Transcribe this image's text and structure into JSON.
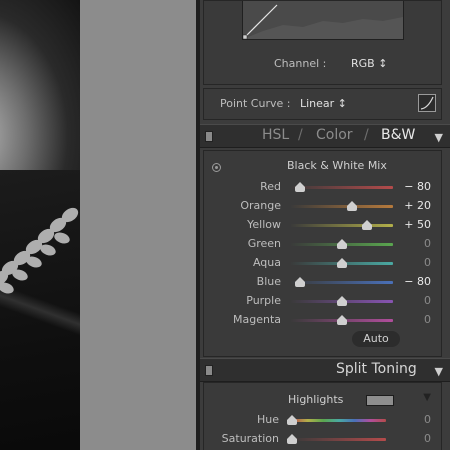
{
  "tone_curve": {
    "channel_label": "Channel :",
    "channel_value": "RGB ↕",
    "point_curve_label": "Point Curve :",
    "point_curve_value": "Linear ↕"
  },
  "hsl_header": {
    "tabs": [
      "HSL",
      "/",
      "Color",
      "/",
      "B&W"
    ],
    "collapse_icon": "triangle-down-icon"
  },
  "bw_mix": {
    "title": "Black & White Mix",
    "target_icon": "targeted-adjustment-icon",
    "sliders": [
      {
        "name": "Red",
        "value": "− 80",
        "level": -80,
        "track": "#b44b4b"
      },
      {
        "name": "Orange",
        "value": "+ 20",
        "level": 20,
        "track": "#b67a3c"
      },
      {
        "name": "Yellow",
        "value": "+ 50",
        "level": 50,
        "track": "#b3b04a"
      },
      {
        "name": "Green",
        "value": "0",
        "level": 0,
        "track": "#5aa64f"
      },
      {
        "name": "Aqua",
        "value": "0",
        "level": 0,
        "track": "#4aa9a3"
      },
      {
        "name": "Blue",
        "value": "− 80",
        "level": -80,
        "track": "#4a70b8"
      },
      {
        "name": "Purple",
        "value": "0",
        "level": 0,
        "track": "#8854b3"
      },
      {
        "name": "Magenta",
        "value": "0",
        "level": 0,
        "track": "#b14e9c"
      }
    ],
    "auto_label": "Auto"
  },
  "split_toning": {
    "title": "Split Toning",
    "highlights_label": "Highlights",
    "highlights_swatch": "#8e8e8e",
    "sliders": [
      {
        "name": "Hue",
        "value": "0",
        "level": 0
      },
      {
        "name": "Saturation",
        "value": "0",
        "level": 0
      }
    ]
  }
}
